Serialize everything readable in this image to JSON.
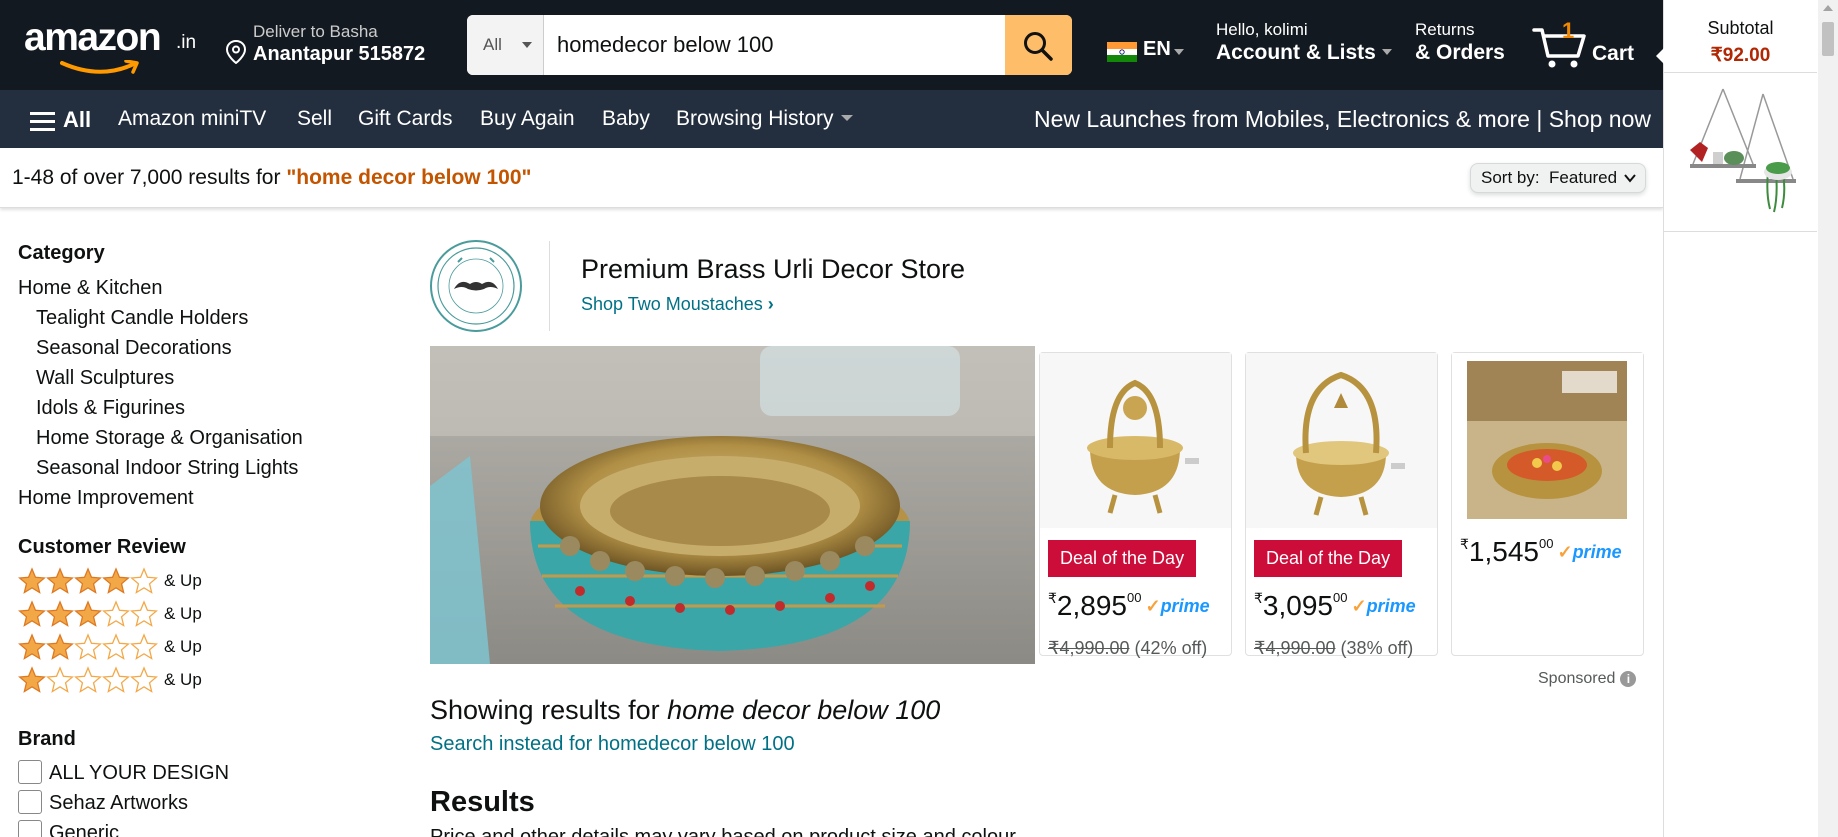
{
  "header": {
    "logo_text": "amazon",
    "logo_suffix": ".in",
    "deliver_line1": "Deliver to Basha",
    "deliver_line2": "Anantapur 515872",
    "search_category": "All",
    "search_value": "homedecor below 100",
    "language": "EN",
    "account_line1": "Hello, kolimi",
    "account_line2": "Account & Lists",
    "orders_line1": "Returns",
    "orders_line2": "& Orders",
    "cart_count": "1",
    "cart_label": "Cart"
  },
  "nav": {
    "all": "All",
    "items": [
      "Amazon miniTV",
      "Sell",
      "Gift Cards",
      "Buy Again",
      "Baby",
      "Browsing History"
    ],
    "promo": "New Launches from Mobiles, Electronics & more | Shop now"
  },
  "results_bar": {
    "count_text": "1-48 of over 7,000 results for ",
    "query": "\"home decor below 100\"",
    "sort_label": "Sort by:",
    "sort_value": "Featured"
  },
  "sidebar": {
    "category_heading": "Category",
    "categories": [
      "Home & Kitchen",
      "Tealight Candle Holders",
      "Seasonal Decorations",
      "Wall Sculptures",
      "Idols & Figurines",
      "Home Storage & Organisation",
      "Seasonal Indoor String Lights",
      "Home Improvement"
    ],
    "review_heading": "Customer Review",
    "review_rows": [
      {
        "stars": 4,
        "label": "& Up"
      },
      {
        "stars": 3,
        "label": "& Up"
      },
      {
        "stars": 2,
        "label": "& Up"
      },
      {
        "stars": 1,
        "label": "& Up"
      }
    ],
    "brand_heading": "Brand",
    "brands": [
      "ALL YOUR DESIGN",
      "Sehaz Artworks",
      "Generic"
    ]
  },
  "sponsored_brand": {
    "title": "Premium Brass Urli Decor Store",
    "link": "Shop Two Moustaches",
    "products": [
      {
        "badge": "Deal of the Day",
        "price_whole": "2,895",
        "price_frac": "00",
        "mrp": "₹4,990.00",
        "discount": "(42% off)"
      },
      {
        "badge": "Deal of the Day",
        "price_whole": "3,095",
        "price_frac": "00",
        "mrp": "₹4,990.00",
        "discount": "(38% off)"
      },
      {
        "badge": "",
        "price_whole": "1,545",
        "price_frac": "00",
        "mrp": "",
        "discount": ""
      }
    ],
    "currency_symbol": "₹",
    "prime_label": "prime",
    "sponsored_label": "Sponsored"
  },
  "results": {
    "showing_prefix": "Showing results for ",
    "showing_query": "home decor below 100",
    "search_instead": "Search instead for homedecor below 100",
    "heading": "Results",
    "subtext": "Price and other details may vary based on product size and colour."
  },
  "cart_rail": {
    "subtotal_label": "Subtotal",
    "subtotal_value": "₹92.00"
  },
  "colors": {
    "header_bg": "#131921",
    "nav_bg": "#232f3e",
    "search_button": "#febd69",
    "link": "#007185",
    "query_highlight": "#c45500",
    "deal_badge": "#cc0c39",
    "price_red": "#b12704",
    "star": "#f3a847"
  },
  "icons": [
    "location-pin-icon",
    "search-icon",
    "india-flag-icon",
    "cart-icon",
    "hamburger-menu-icon",
    "chevron-down-icon",
    "star-icon",
    "info-icon"
  ]
}
